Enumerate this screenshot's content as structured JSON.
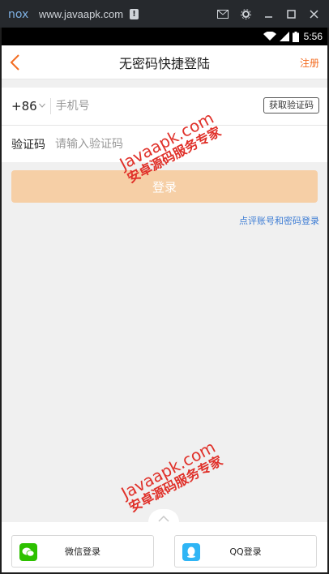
{
  "emulator": {
    "title": "www.javaapk.com",
    "logo_label": "nox",
    "warning_mark": "!"
  },
  "status_bar": {
    "time": "5:56"
  },
  "header": {
    "title": "无密码快捷登陆",
    "register_label": "注册"
  },
  "form": {
    "country_code": "+86",
    "phone_placeholder": "手机号",
    "get_code_label": "获取验证码",
    "code_label": "验证码",
    "code_placeholder": "请输入验证码"
  },
  "login_button": "登录",
  "alt_login_link": "点评账号和密码登录",
  "watermark": {
    "line1": "Javaapk.com",
    "line2": "安卓源码服务专家"
  },
  "social": {
    "wechat_label": "微信登录",
    "qq_label": "QQ登录"
  },
  "colors": {
    "accent": "#f36c21",
    "login_button_disabled": "#f6cfa6",
    "link": "#3b7bd4",
    "wechat": "#2dc100",
    "qq": "#2fb5f5",
    "watermark": "#e0312a"
  }
}
